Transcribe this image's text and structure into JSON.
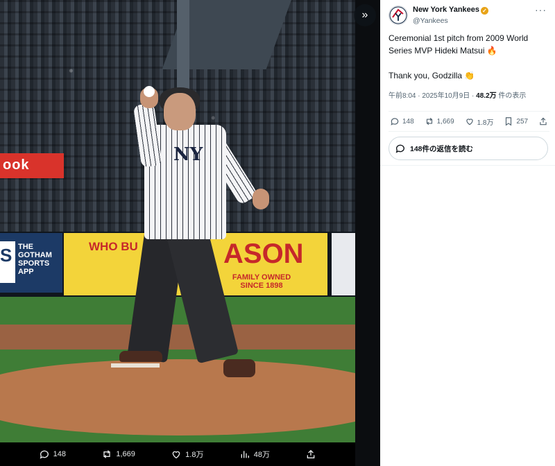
{
  "media_bar": {
    "replies": "148",
    "reposts": "1,669",
    "likes": "1.8万",
    "views": "48万"
  },
  "ads": {
    "reebok": "ook",
    "gotham_square": "S",
    "gotham": "THE GOTHAM SPORTS APP",
    "mason_who": "WHO BU",
    "mason_big": "ASON",
    "mason_sub": "FAMILY OWNED SINCE 1898"
  },
  "jersey_logo": "NY",
  "tweet": {
    "account_name": "New York Yankees",
    "handle": "@Yankees",
    "more": "···",
    "text_line1": "Ceremonial 1st pitch from 2009 World Series MVP Hideki Matsui 🔥",
    "text_line2": "Thank you, Godzilla 👏",
    "timestamp": "午前8:04 · 2025年10月9日 · ",
    "views_count": "48.2万",
    "views_label": " 件の表示",
    "replies": "148",
    "reposts": "1,669",
    "likes": "1.8万",
    "bookmarks": "257",
    "read_replies": "148件の返信を読む"
  },
  "colors": {
    "panel_bg": "#ffffff",
    "text_primary": "#0f1419",
    "text_secondary": "#536471",
    "verified": "#e8a317"
  }
}
